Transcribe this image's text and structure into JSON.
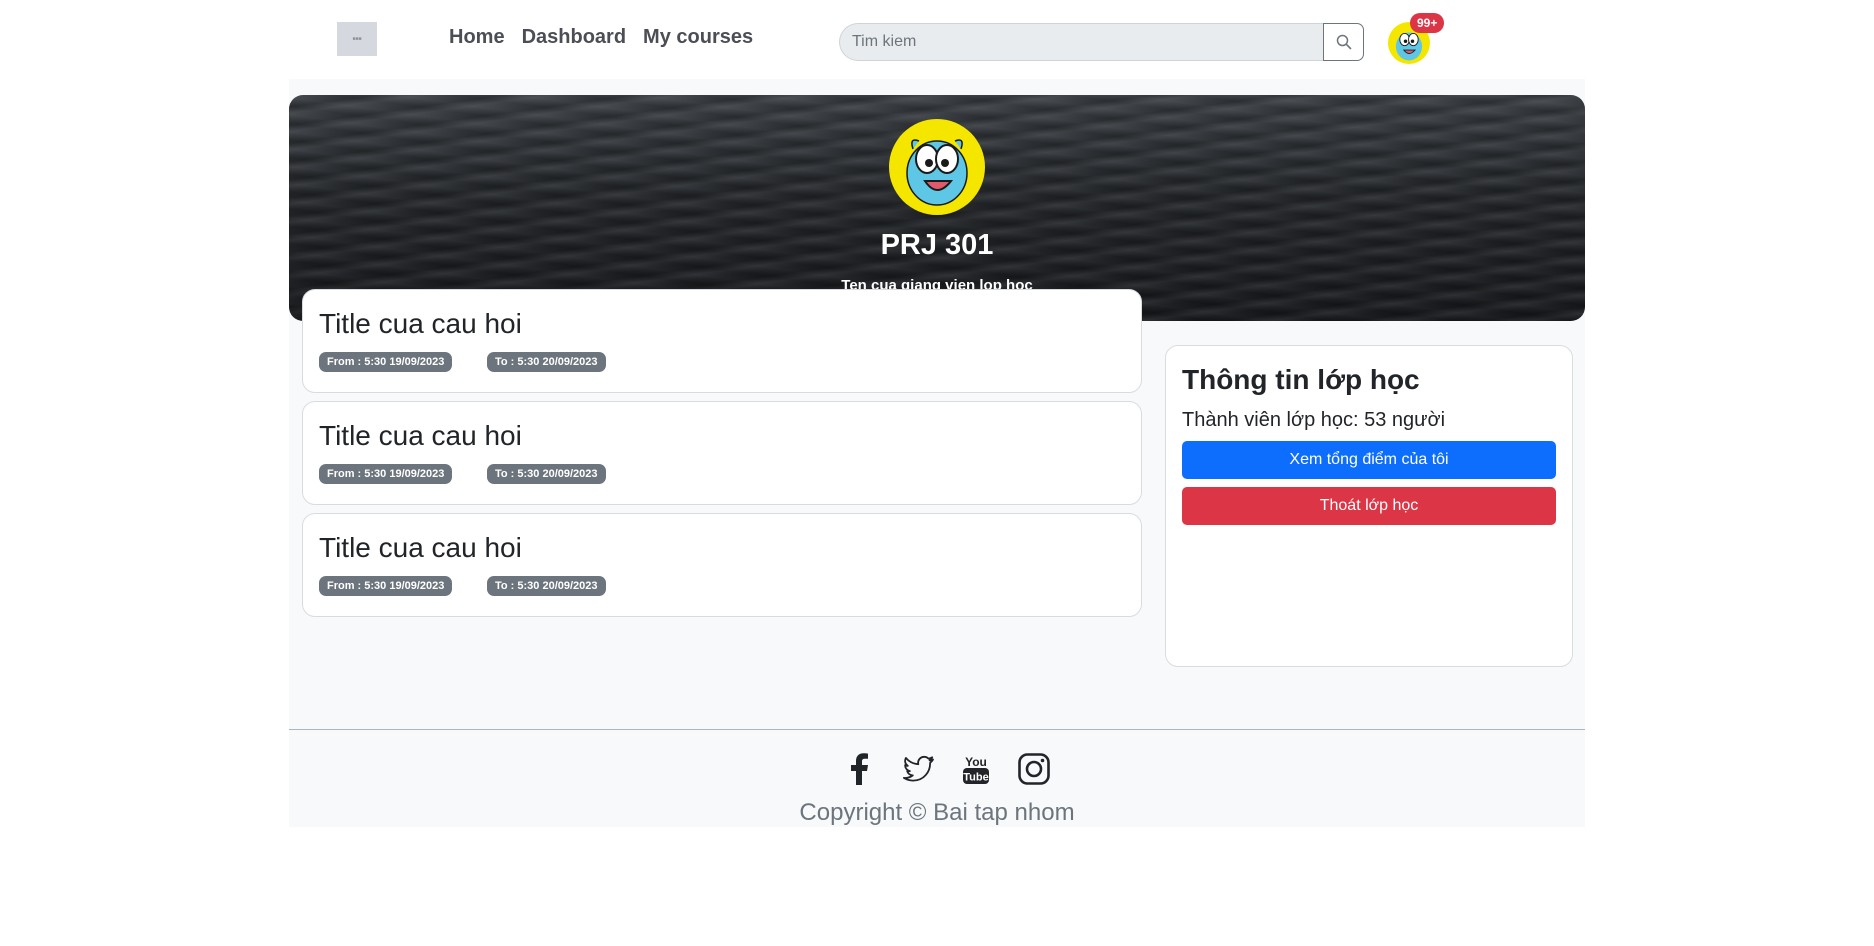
{
  "nav": {
    "links": [
      "Home",
      "Dashboard",
      "My courses"
    ],
    "search_placeholder": "Tim kiem",
    "notification_count": "99+"
  },
  "banner": {
    "course_code": "PRJ 301",
    "teacher": "Ten cua giang vien lop hoc"
  },
  "questions": [
    {
      "title": "Title cua cau hoi",
      "from": "From : 5:30 19/09/2023",
      "to": "To : 5:30 20/09/2023"
    },
    {
      "title": "Title cua cau hoi",
      "from": "From : 5:30 19/09/2023",
      "to": "To : 5:30 20/09/2023"
    },
    {
      "title": "Title cua cau hoi",
      "from": "From : 5:30 19/09/2023",
      "to": "To : 5:30 20/09/2023"
    }
  ],
  "info": {
    "title": "Thông tin lớp học",
    "members": "Thành viên lớp học: 53 người",
    "score_button": "Xem tổng điểm của tôi",
    "leave_button": "Thoát lớp học"
  },
  "footer": {
    "social_icons": [
      "facebook-icon",
      "twitter-icon",
      "youtube-icon",
      "instagram-icon"
    ],
    "copyright": "Copyright © Bai tap nhom"
  },
  "colors": {
    "primary": "#0d6efd",
    "danger": "#dc3545",
    "badge": "#6c757d",
    "avatar_bg": "#f5e600",
    "gumball_blue": "#5ec7e6"
  }
}
